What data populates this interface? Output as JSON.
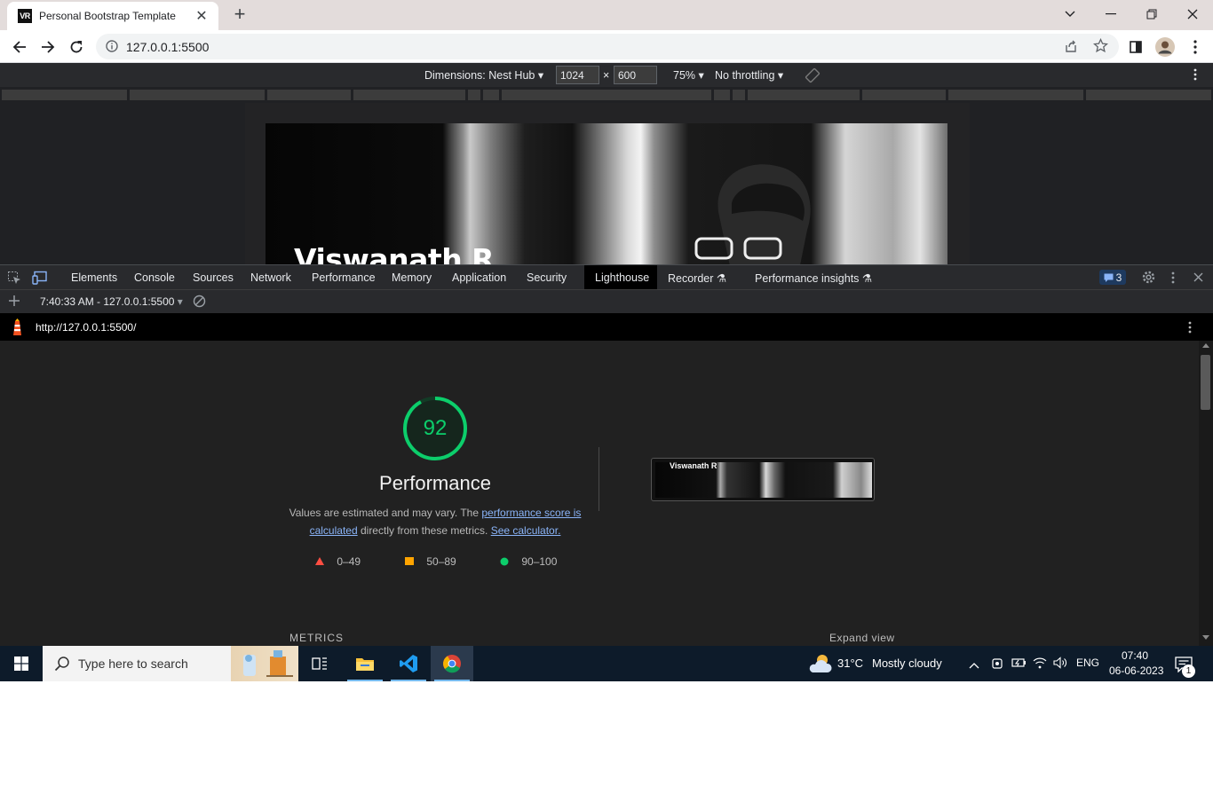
{
  "browser": {
    "tab_favicon": "VR",
    "tab_title": "Personal Bootstrap Template",
    "url": "127.0.0.1:5500"
  },
  "device_toolbar": {
    "dimensions_label": "Dimensions: Nest Hub",
    "width": "1024",
    "height": "600",
    "times": "×",
    "zoom": "75%",
    "throttling": "No throttling"
  },
  "viewport": {
    "hero_name": "Viswanath R"
  },
  "devtools": {
    "tabs": [
      "Elements",
      "Console",
      "Sources",
      "Network",
      "Performance",
      "Memory",
      "Application",
      "Security",
      "Lighthouse",
      "Recorder",
      "Performance insights"
    ],
    "issues_count": "3",
    "report_selector": "7:40:33 AM - 127.0.0.1:5500",
    "report_url": "http://127.0.0.1:5500/"
  },
  "lighthouse": {
    "score": "92",
    "category": "Performance",
    "desc_prefix": "Values are estimated and may vary. The ",
    "desc_link1": "performance score is calculated",
    "desc_mid": " directly from these metrics. ",
    "desc_link2": "See calculator.",
    "legend": [
      {
        "range": "0–49",
        "color": "#ff4e42"
      },
      {
        "range": "50–89",
        "color": "#ffa400"
      },
      {
        "range": "90–100",
        "color": "#0cce6b"
      }
    ],
    "metrics_label": "METRICS",
    "expand_label": "Expand view",
    "thumb_name": "Viswanath R"
  },
  "taskbar": {
    "search_placeholder": "Type here to search",
    "weather_temp": "31°C",
    "weather_text": "Mostly cloudy",
    "lang": "ENG",
    "time": "07:40",
    "date": "06-06-2023",
    "notification_count": "1"
  }
}
